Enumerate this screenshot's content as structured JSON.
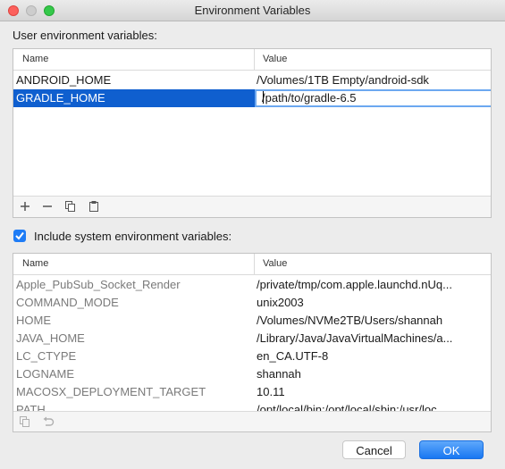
{
  "window": {
    "title": "Environment Variables"
  },
  "user_section": {
    "label": "User environment variables:",
    "columns": [
      "Name",
      "Value"
    ],
    "rows": [
      {
        "name": "ANDROID_HOME",
        "value": "/Volumes/1TB Empty/android-sdk"
      },
      {
        "name": "GRADLE_HOME",
        "value": "/path/to/gradle-6.5"
      }
    ],
    "selected_row": "GRADLE_HOME",
    "toolbar_icons": [
      "add-icon",
      "remove-icon",
      "copy-icon",
      "paste-icon"
    ]
  },
  "system_section": {
    "checkbox_label": "Include system environment variables:",
    "checked": true,
    "columns": [
      "Name",
      "Value"
    ],
    "rows": [
      {
        "name": "Apple_PubSub_Socket_Render",
        "value": "/private/tmp/com.apple.launchd.nUq..."
      },
      {
        "name": "COMMAND_MODE",
        "value": "unix2003"
      },
      {
        "name": "HOME",
        "value": "/Volumes/NVMe2TB/Users/shannah"
      },
      {
        "name": "JAVA_HOME",
        "value": "/Library/Java/JavaVirtualMachines/a..."
      },
      {
        "name": "LC_CTYPE",
        "value": "en_CA.UTF-8"
      },
      {
        "name": "LOGNAME",
        "value": "shannah"
      },
      {
        "name": "MACOSX_DEPLOYMENT_TARGET",
        "value": "10.11"
      },
      {
        "name": "PATH",
        "value": "/opt/local/bin:/opt/local/sbin:/usr/loc..."
      }
    ],
    "toolbar_icons": [
      "copy-icon",
      "revert-icon"
    ]
  },
  "buttons": {
    "cancel": "Cancel",
    "ok": "OK"
  },
  "colors": {
    "selection": "#0f5fcf",
    "accent": "#1877f2",
    "edit_border": "#6ca8f0"
  }
}
